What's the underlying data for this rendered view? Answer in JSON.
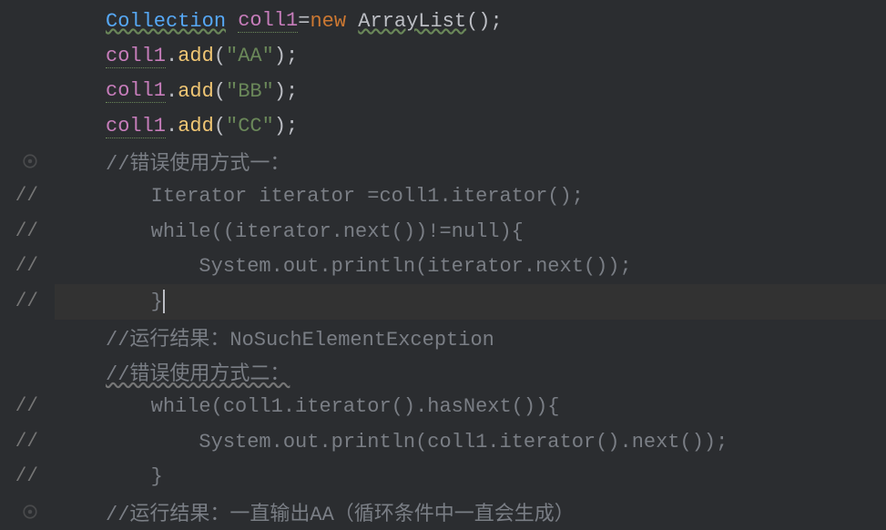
{
  "code": {
    "line1": {
      "type": "Collection",
      "var": "coll1",
      "op": "=",
      "keyword": "new",
      "ctor": "ArrayList",
      "parens": "()",
      "semi": ";"
    },
    "line2": {
      "var": "coll1",
      "dot": ".",
      "method": "add",
      "open": "(",
      "str": "\"AA\"",
      "close": ")",
      "semi": ";"
    },
    "line3": {
      "var": "coll1",
      "dot": ".",
      "method": "add",
      "open": "(",
      "str": "\"BB\"",
      "close": ")",
      "semi": ";"
    },
    "line4": {
      "var": "coll1",
      "dot": ".",
      "method": "add",
      "open": "(",
      "str": "\"CC\"",
      "close": ")",
      "semi": ";"
    },
    "line5": {
      "comment": "//错误使用方式一："
    },
    "line6": {
      "prefix": "//",
      "text": "        Iterator iterator =coll1.iterator();"
    },
    "line7": {
      "prefix": "//",
      "text": "        while((iterator.next())!=null){"
    },
    "line8": {
      "prefix": "//",
      "text": "            System.out.println(iterator.next());"
    },
    "line9": {
      "prefix": "//",
      "text": "        }"
    },
    "line10": {
      "comment": "//运行结果：NoSuchElementException"
    },
    "line11": {
      "comment": "//错误使用方式二："
    },
    "line12": {
      "prefix": "//",
      "text": "        while(coll1.iterator().hasNext()){"
    },
    "line13": {
      "prefix": "//",
      "text": "            System.out.println(coll1.iterator().next());"
    },
    "line14": {
      "prefix": "//",
      "text": "        }"
    },
    "line15": {
      "comment": "//运行结果：一直输出AA（循环条件中一直会生成）"
    }
  }
}
